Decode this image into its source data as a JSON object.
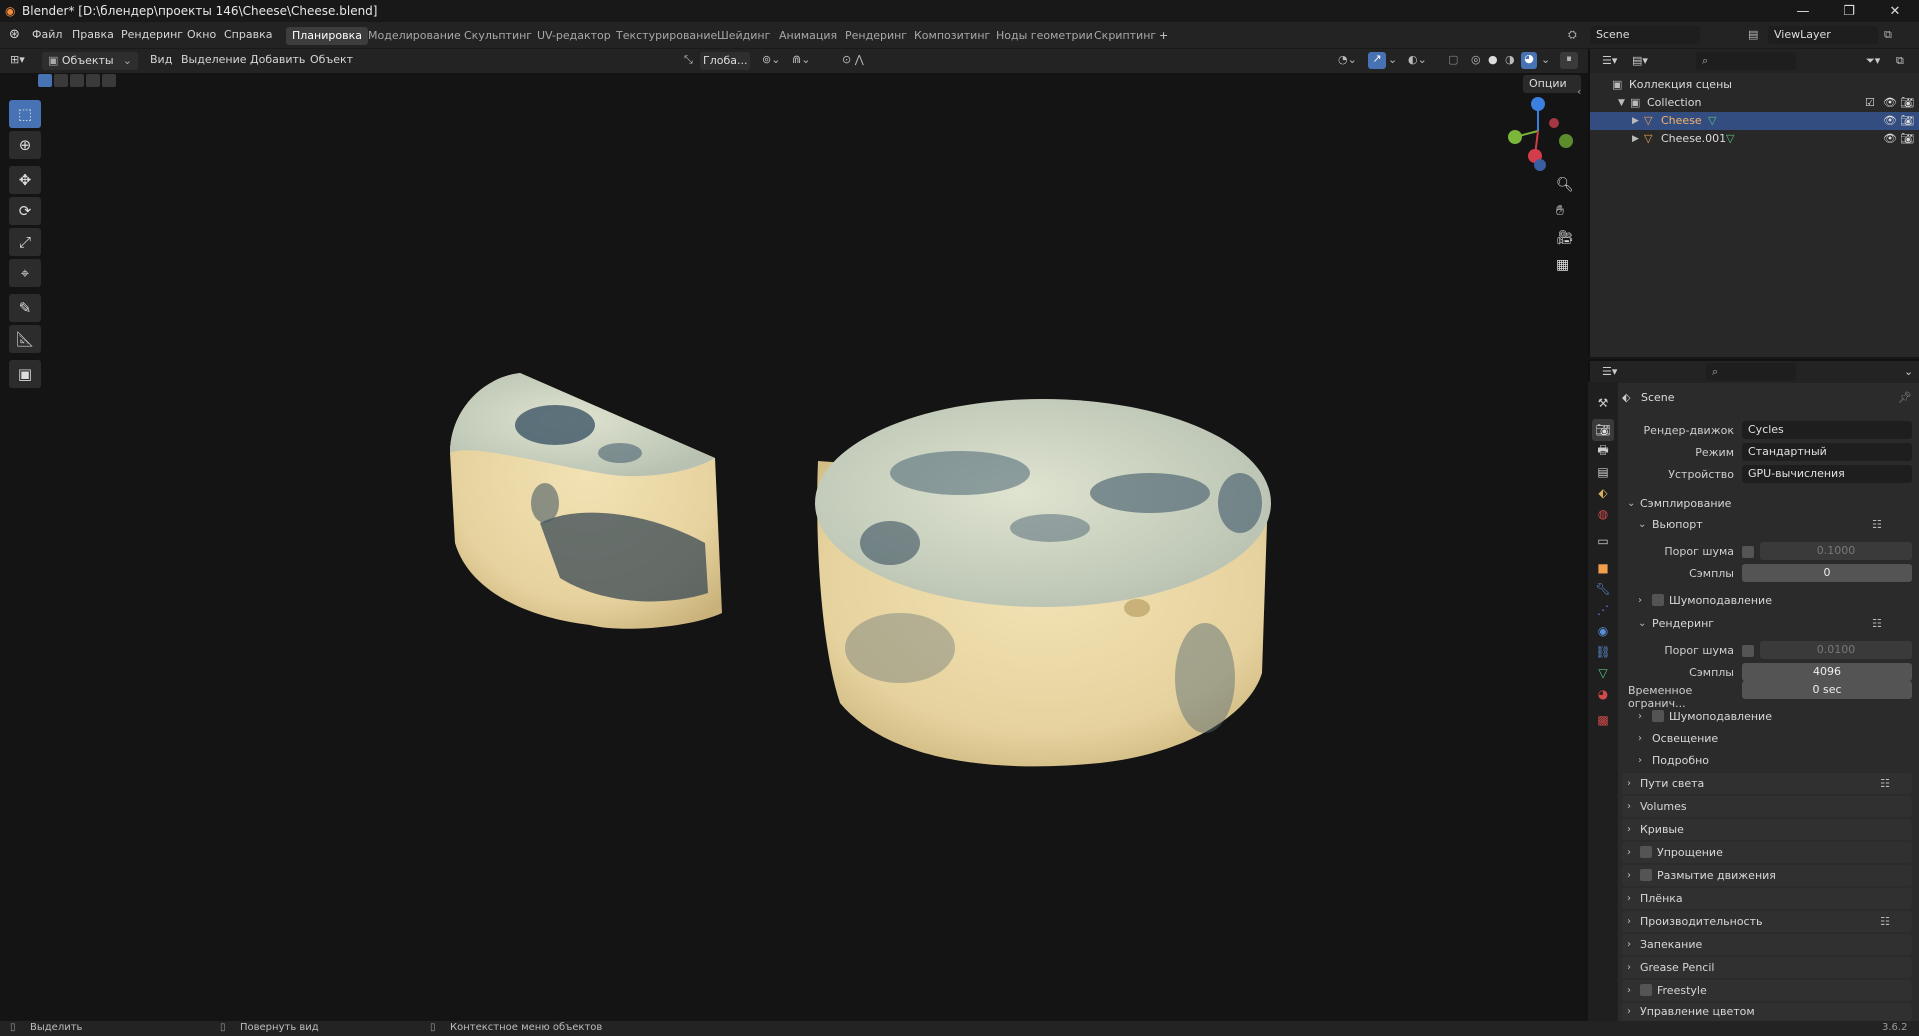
{
  "window": {
    "title": "Blender* [D:\\блендер\\проекты 146\\Cheese\\Cheese.blend]",
    "min": "—",
    "max": "❐",
    "close": "✕"
  },
  "menu": [
    "Файл",
    "Правка",
    "Рендеринг",
    "Окно",
    "Справка"
  ],
  "workspaces": [
    "Планировка",
    "Моделирование",
    "Скульптинг",
    "UV-редактор",
    "Текстурирование",
    "Шейдинг",
    "Анимация",
    "Рендеринг",
    "Композитинг",
    "Ноды геометрии",
    "Скриптинг"
  ],
  "workspace_add": "+",
  "scene_field": "Scene",
  "viewlayer_field": "ViewLayer",
  "viewport_header": {
    "mode": "Объекты",
    "menus": [
      "Вид",
      "Выделение",
      "Добавить",
      "Объект"
    ],
    "transform_orientation": "Глоба...",
    "options": "Опции"
  },
  "outliner": {
    "scene_collection": "Коллекция сцены",
    "items": [
      {
        "name": "Collection"
      },
      {
        "name": "Cheese",
        "selected": true
      },
      {
        "name": "Cheese.001"
      }
    ]
  },
  "properties": {
    "context": "Scene",
    "render_engine_label": "Рендер-движок",
    "render_engine": "Cycles",
    "mode_label": "Режим",
    "mode": "Стандартный",
    "device_label": "Устройство",
    "device": "GPU-вычисления",
    "sampling": "Сэмплирование",
    "viewport": "Вьюпорт",
    "vp_noise_label": "Порог шума",
    "vp_noise": "0.1000",
    "vp_samples_label": "Сэмплы",
    "vp_samples": "0",
    "vp_denoise": "Шумоподавление",
    "render": "Рендеринг",
    "r_noise_label": "Порог шума",
    "r_noise": "0.0100",
    "r_samples_label": "Сэмплы",
    "r_samples": "4096",
    "time_limit_label": "Временное огранич...",
    "time_limit": "0 sec",
    "r_denoise": "Шумоподавление",
    "lighting": "Освещение",
    "advanced": "Подробно",
    "panels": [
      "Пути света",
      "Volumes",
      "Кривые",
      "Упрощение",
      "Размытие движения",
      "Плёнка",
      "Производительность",
      "Запекание",
      "Grease Pencil",
      "Freestyle",
      "Управление цветом"
    ]
  },
  "statusbar": {
    "select": "Выделить",
    "rotate": "Повернуть вид",
    "context_menu": "Контекстное меню объектов",
    "version": "3.6.2"
  },
  "colors": {
    "accent": "#4772b3",
    "selection": "#334d80",
    "gizmo_x": "#d33c4a",
    "gizmo_y": "#7bb53a",
    "gizmo_z": "#3b7fe0"
  }
}
